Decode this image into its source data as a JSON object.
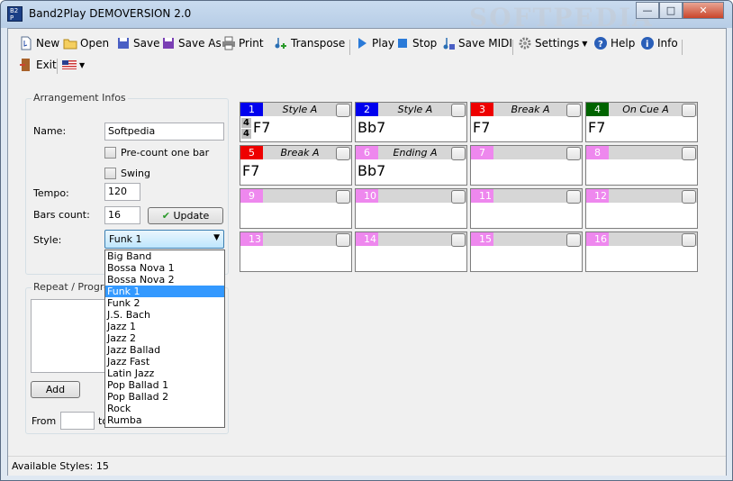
{
  "window": {
    "title": "Band2Play DEMOVERSION 2.0",
    "watermark": "SOFTPEDIA"
  },
  "toolbar": {
    "new": "New",
    "open": "Open",
    "save": "Save",
    "save_as": "Save As",
    "print": "Print",
    "transpose": "Transpose",
    "play": "Play",
    "stop": "Stop",
    "save_midi": "Save MIDI",
    "settings": "Settings",
    "help": "Help",
    "info": "Info",
    "exit": "Exit"
  },
  "arrangement": {
    "group_title": "Arrangement Infos",
    "name_label": "Name:",
    "name_value": "Softpedia",
    "precount_label": "Pre-count one bar",
    "precount_checked": false,
    "swing_label": "Swing",
    "swing_checked": false,
    "tempo_label": "Tempo:",
    "tempo_value": "120",
    "bars_label": "Bars count:",
    "bars_value": "16",
    "update_button": "Update",
    "style_label": "Style:",
    "style_value": "Funk 1"
  },
  "style_options": [
    "Big Band",
    "Bossa Nova 1",
    "Bossa Nova 2",
    "Funk 1",
    "Funk 2",
    "J.S. Bach",
    "Jazz 1",
    "Jazz 2",
    "Jazz Ballad",
    "Jazz Fast",
    "Latin Jazz",
    "Pop Ballad 1",
    "Pop Ballad 2",
    "Rock",
    "Rumba"
  ],
  "repeat": {
    "group_title": "Repeat / Progres",
    "add_button": "Add",
    "from_label": "From",
    "from_value": "",
    "to_label": "to"
  },
  "bars": [
    {
      "num": "1",
      "name": "Style A",
      "chord": "F7",
      "color": "#0000ee",
      "timesig": [
        "4",
        "4"
      ]
    },
    {
      "num": "2",
      "name": "Style A",
      "chord": "Bb7",
      "color": "#0000ee"
    },
    {
      "num": "3",
      "name": "Break A",
      "chord": "F7",
      "color": "#ee0000"
    },
    {
      "num": "4",
      "name": "On Cue A",
      "chord": "F7",
      "color": "#006400"
    },
    {
      "num": "5",
      "name": "Break A",
      "chord": "F7",
      "color": "#ee0000"
    },
    {
      "num": "6",
      "name": "Ending A",
      "chord": "Bb7",
      "color": "#ee88ee"
    },
    {
      "num": "7",
      "name": "",
      "chord": "",
      "color": "#ee88ee"
    },
    {
      "num": "8",
      "name": "",
      "chord": "",
      "color": "#ee88ee"
    },
    {
      "num": "9",
      "name": "",
      "chord": "",
      "color": "#ee88ee"
    },
    {
      "num": "10",
      "name": "",
      "chord": "",
      "color": "#ee88ee"
    },
    {
      "num": "11",
      "name": "",
      "chord": "",
      "color": "#ee88ee"
    },
    {
      "num": "12",
      "name": "",
      "chord": "",
      "color": "#ee88ee"
    },
    {
      "num": "13",
      "name": "",
      "chord": "",
      "color": "#ee88ee"
    },
    {
      "num": "14",
      "name": "",
      "chord": "",
      "color": "#ee88ee"
    },
    {
      "num": "15",
      "name": "",
      "chord": "",
      "color": "#ee88ee"
    },
    {
      "num": "16",
      "name": "",
      "chord": "",
      "color": "#ee88ee"
    }
  ],
  "status": {
    "label": "Available Styles:",
    "count": "15"
  }
}
